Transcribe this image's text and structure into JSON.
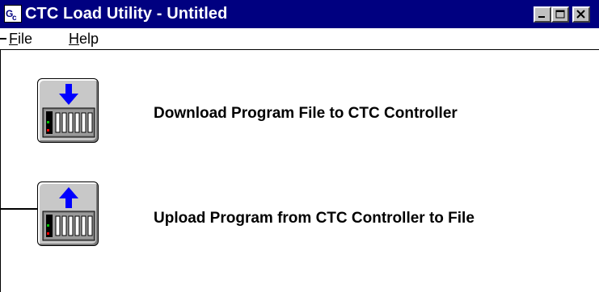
{
  "window": {
    "title": "CTC Load Utility - Untitled",
    "icon_name": "ctc-app-icon",
    "title_color": "#000080"
  },
  "menu": {
    "file_first": "F",
    "file_rest": "ile",
    "help_first": "H",
    "help_rest": "elp"
  },
  "actions": {
    "download": {
      "label": "Download Program File to CTC Controller",
      "icon": "controller-download-icon",
      "arrow_color": "#0000ff"
    },
    "upload": {
      "label": "Upload Program from CTC Controller to File",
      "icon": "controller-upload-icon",
      "arrow_color": "#0000ff"
    }
  }
}
